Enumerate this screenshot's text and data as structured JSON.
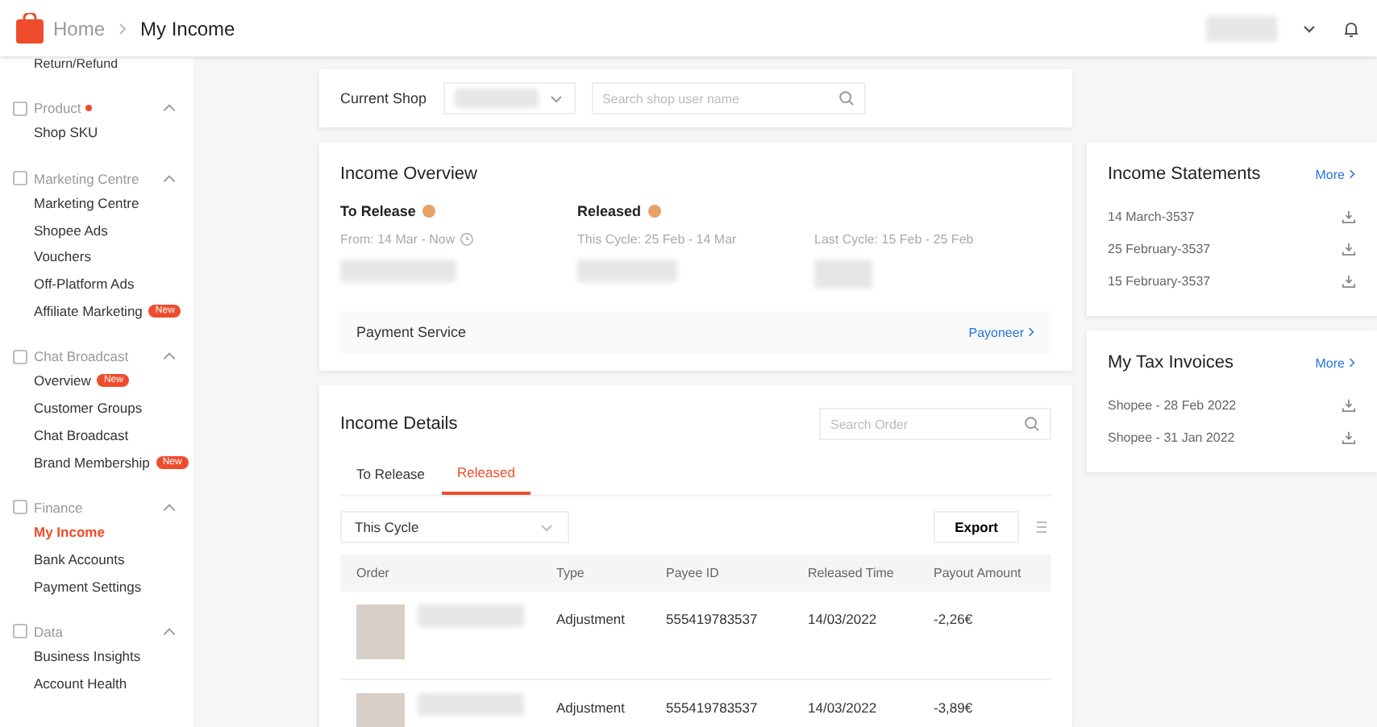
{
  "header": {
    "breadcrumb": [
      {
        "label": "Home",
        "selected": false
      },
      {
        "label": "My Income",
        "selected": true
      }
    ]
  },
  "sidebar": {
    "top_item": "Return/Refund",
    "groups": [
      {
        "title": "Product",
        "has_dot": true,
        "expanded": true,
        "items": [
          {
            "label": "Shop SKU",
            "selected": false
          }
        ]
      },
      {
        "title": "Marketing Centre",
        "has_dot": false,
        "expanded": true,
        "items": [
          {
            "label": "Marketing Centre",
            "selected": false
          },
          {
            "label": "Shopee Ads",
            "selected": false
          },
          {
            "label": "Vouchers",
            "selected": false
          },
          {
            "label": "Off-Platform Ads",
            "selected": false
          },
          {
            "label": "Affiliate Marketing",
            "badge": "New",
            "selected": false
          }
        ]
      },
      {
        "title": "Chat Broadcast",
        "has_dot": false,
        "expanded": true,
        "items": [
          {
            "label": "Overview",
            "badge": "New",
            "selected": false
          },
          {
            "label": "Customer Groups",
            "selected": false
          },
          {
            "label": "Chat Broadcast",
            "selected": false
          },
          {
            "label": "Brand Membership",
            "badge": "New",
            "selected": false
          }
        ]
      },
      {
        "title": "Finance",
        "has_dot": false,
        "expanded": true,
        "items": [
          {
            "label": "My Income",
            "selected": true
          },
          {
            "label": "Bank Accounts",
            "selected": false
          },
          {
            "label": "Payment Settings",
            "selected": false
          }
        ]
      },
      {
        "title": "Data",
        "has_dot": false,
        "expanded": true,
        "items": [
          {
            "label": "Business Insights",
            "selected": false
          },
          {
            "label": "Account Health",
            "selected": false
          }
        ]
      }
    ]
  },
  "shop_bar": {
    "label": "Current Shop",
    "search_placeholder": "Search shop user name"
  },
  "income_overview": {
    "title": "Income Overview",
    "to_release": {
      "title": "To Release",
      "period": "From: 14 Mar - Now"
    },
    "released": {
      "title": "Released",
      "this_cycle": "This Cycle: 25 Feb - 14 Mar",
      "last_cycle": "Last Cycle: 15 Feb - 25 Feb"
    },
    "payment_service": {
      "label": "Payment Service",
      "link": "Payoneer"
    }
  },
  "income_details": {
    "title": "Income Details",
    "search_placeholder": "Search Order",
    "tabs": [
      {
        "label": "To Release",
        "selected": false
      },
      {
        "label": "Released",
        "selected": true
      }
    ],
    "filter": "This Cycle",
    "export": "Export",
    "table": {
      "columns": [
        "Order",
        "Type",
        "Payee ID",
        "Released Time",
        "Payout Amount"
      ],
      "rows": [
        {
          "type": "Adjustment",
          "payee_id": "555419783537",
          "released_time": "14/03/2022",
          "payout_amount": "-2,26€"
        },
        {
          "type": "Adjustment",
          "payee_id": "555419783537",
          "released_time": "14/03/2022",
          "payout_amount": "-3,89€"
        }
      ]
    }
  },
  "income_statements": {
    "title": "Income Statements",
    "more": "More",
    "items": [
      "14 March-3537",
      "25 February-3537",
      "15 February-3537"
    ]
  },
  "tax_invoices": {
    "title": "My Tax Invoices",
    "more": "More",
    "items": [
      "Shopee - 28 Feb 2022",
      "Shopee - 31 Jan 2022"
    ]
  }
}
